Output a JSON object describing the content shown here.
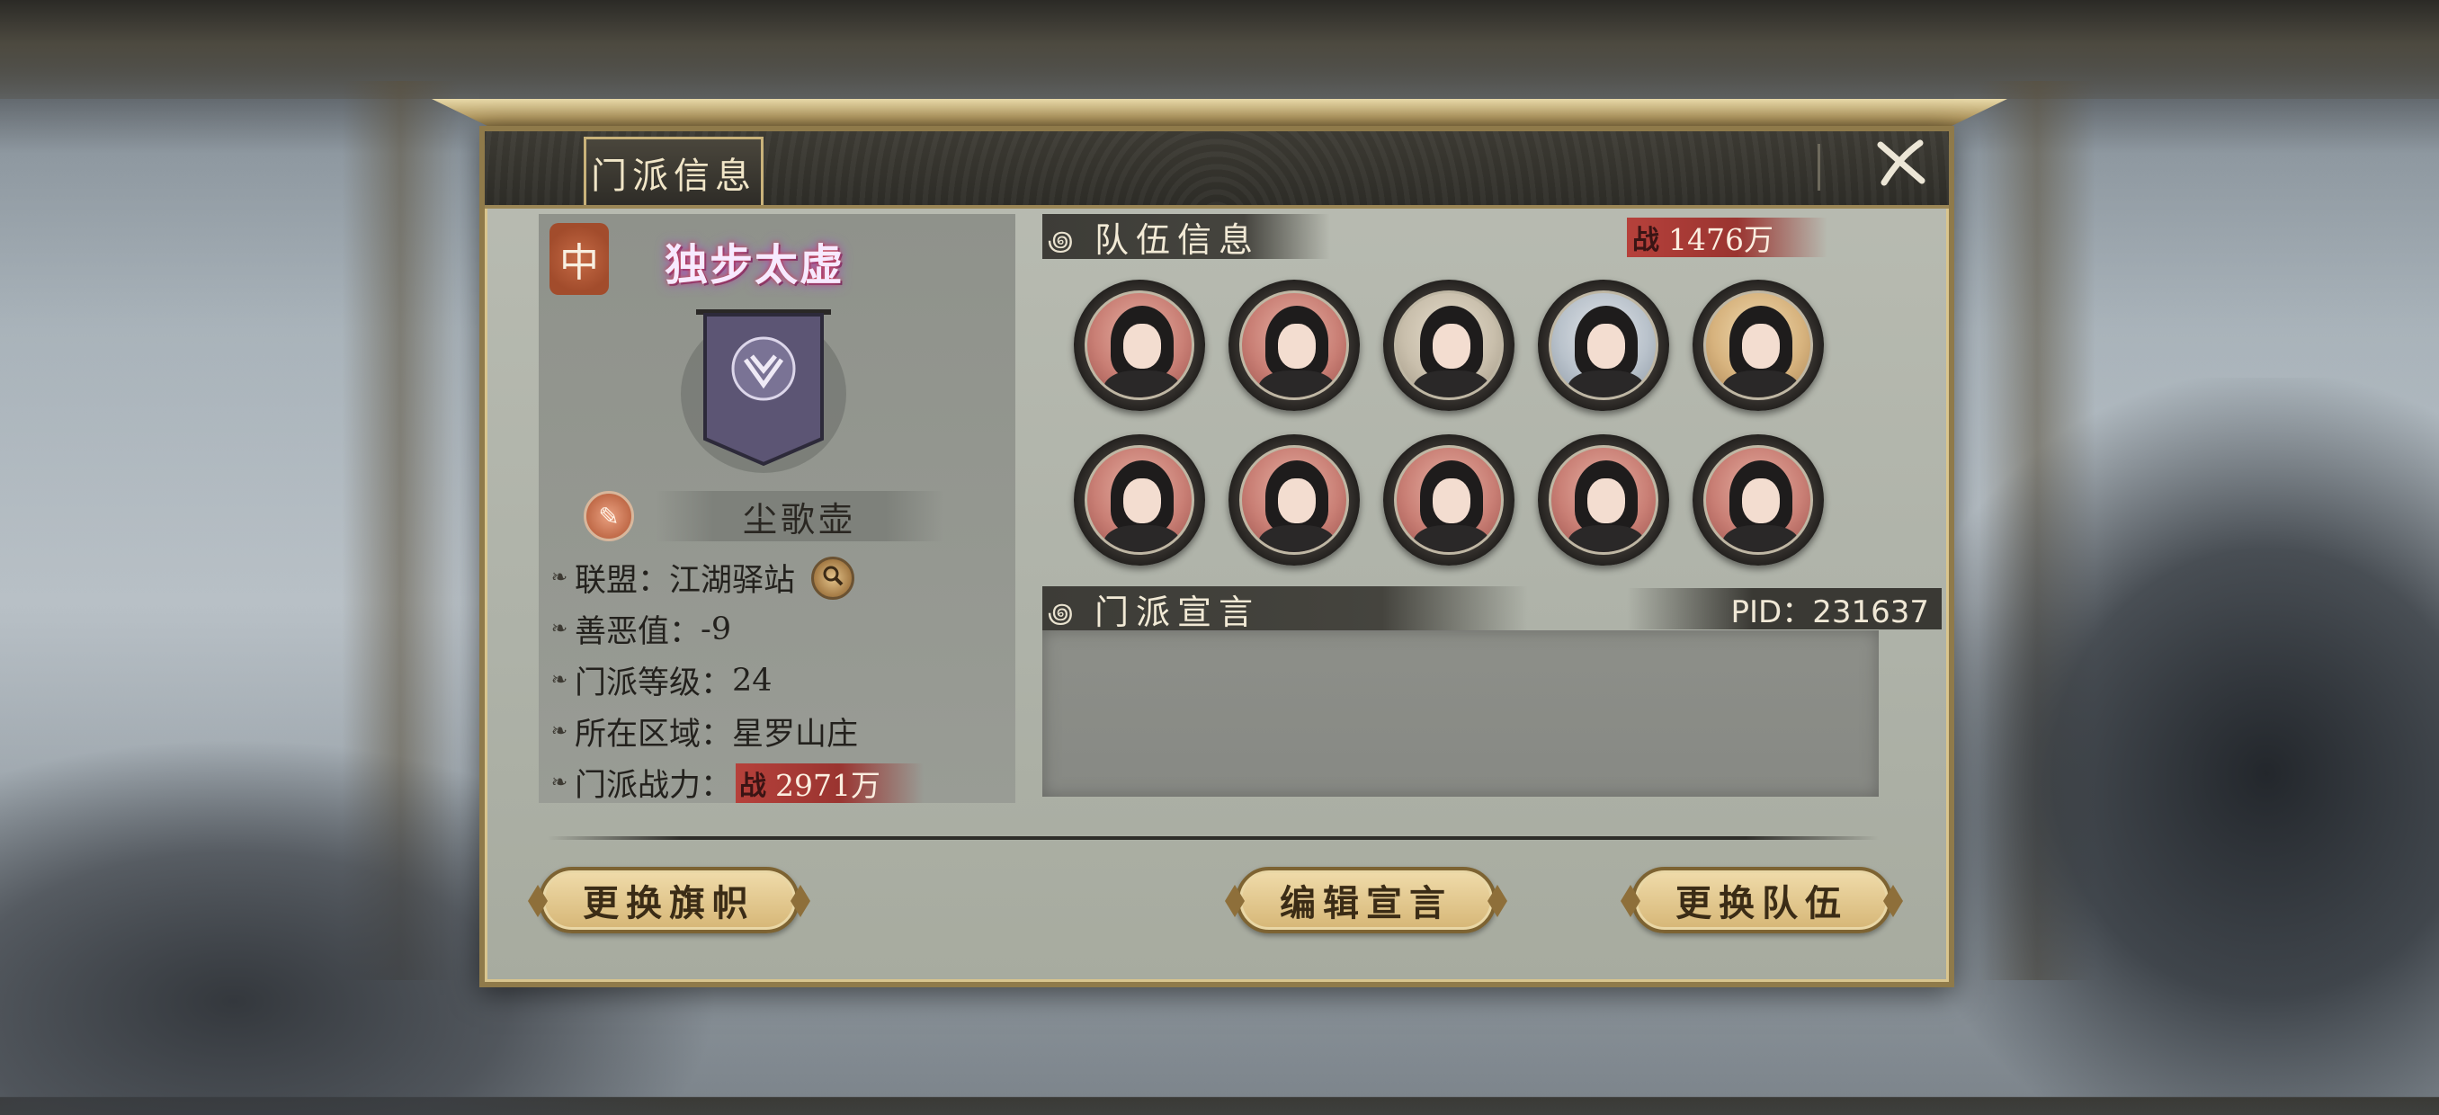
{
  "window": {
    "title": "门派信息"
  },
  "sect": {
    "rank_badge": "中",
    "title": "独步太虚",
    "player_name": "尘歌壶",
    "info": [
      {
        "label": "联盟：",
        "value": "江湖驿站"
      },
      {
        "label": "善恶值：",
        "value": "-9"
      },
      {
        "label": "门派等级：",
        "value": "24"
      },
      {
        "label": "所在区域：",
        "value": "星罗山庄"
      },
      {
        "label": "门派战力：",
        "value": "2971万"
      }
    ]
  },
  "team": {
    "section_title": "队伍信息",
    "power_icon": "战",
    "power": "1476万",
    "members": [
      {
        "avatar": "hat-swordsman-portrait",
        "tone": "red"
      },
      {
        "avatar": "flower-lady-portrait",
        "tone": "red"
      },
      {
        "avatar": "hat-scholar-portrait",
        "tone": "pale"
      },
      {
        "avatar": "sword-lady-portrait",
        "tone": "blue"
      },
      {
        "avatar": "crowned-lady-portrait",
        "tone": "gold"
      },
      {
        "avatar": "longhair-swordsman-portrait",
        "tone": "red"
      },
      {
        "avatar": "bearded-elder-portrait",
        "tone": "red"
      },
      {
        "avatar": "blindfold-lady-portrait",
        "tone": "red"
      },
      {
        "avatar": "ornate-lady-portrait",
        "tone": "red"
      },
      {
        "avatar": "masked-warrior-portrait",
        "tone": "red"
      }
    ]
  },
  "manifesto": {
    "section_title": "门派宣言",
    "pid": "PID：231637",
    "text": ""
  },
  "buttons": {
    "change_flag": "更换旗帜",
    "edit_manifesto": "编辑宣言",
    "change_team": "更换队伍"
  },
  "colors": {
    "power_badge": "#b6413b",
    "button_gold": "#d6b676",
    "header_dark": "#2d2c27"
  }
}
